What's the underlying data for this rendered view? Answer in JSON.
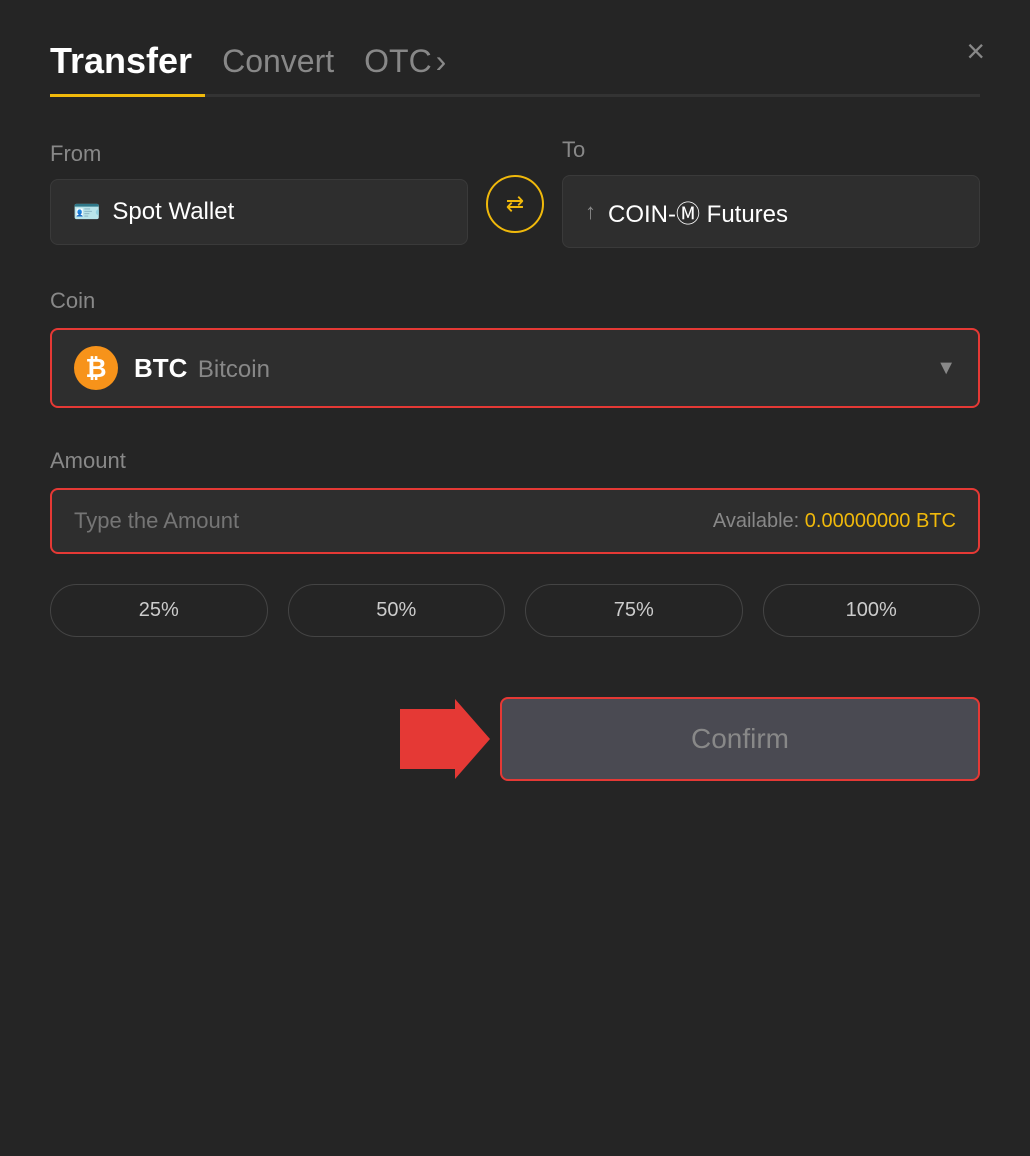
{
  "header": {
    "tab_transfer": "Transfer",
    "tab_convert": "Convert",
    "tab_otc": "OTC",
    "otc_chevron": "›",
    "close_label": "×"
  },
  "from": {
    "label": "From",
    "wallet_name": "Spot Wallet"
  },
  "to": {
    "label": "To",
    "wallet_name": "COIN-Ⓜ Futures"
  },
  "coin": {
    "label": "Coin",
    "symbol": "BTC",
    "name": "Bitcoin"
  },
  "amount": {
    "label": "Amount",
    "placeholder": "Type the Amount",
    "available_label": "Available:",
    "available_value": "0.00000000 BTC"
  },
  "percentages": [
    {
      "label": "25%"
    },
    {
      "label": "50%"
    },
    {
      "label": "75%"
    },
    {
      "label": "100%"
    }
  ],
  "confirm_button": "Confirm"
}
